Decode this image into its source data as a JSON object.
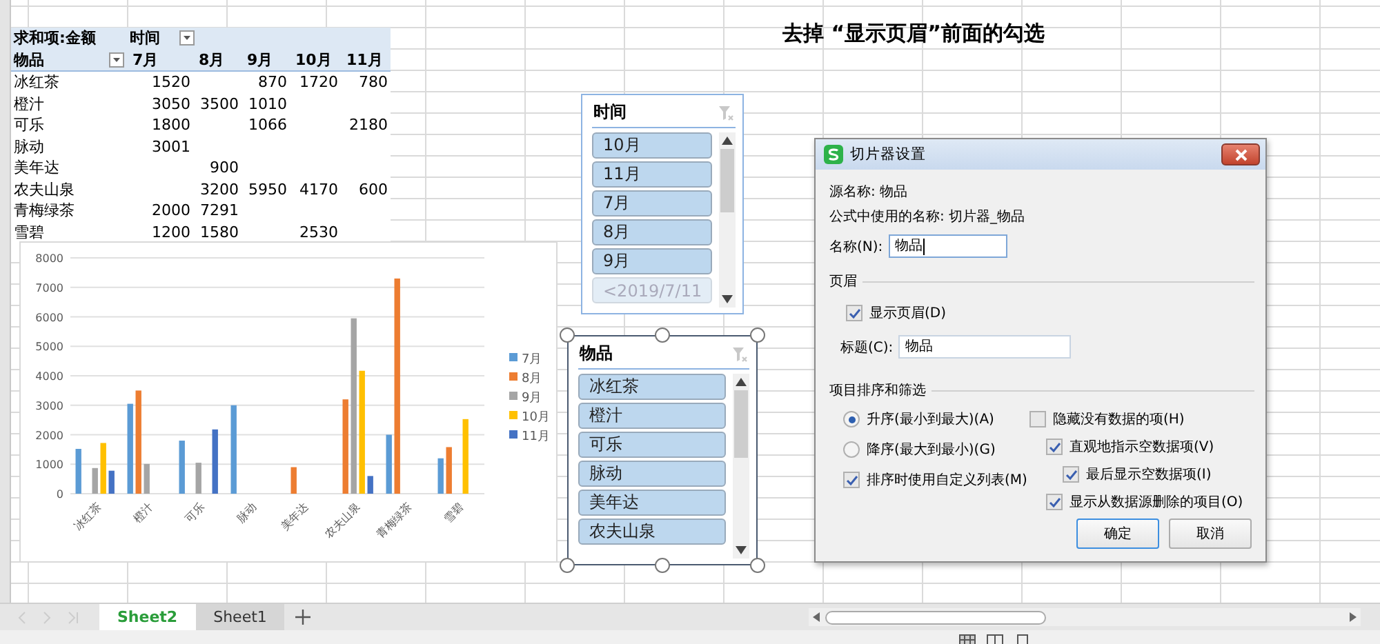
{
  "note": "去掉 “显示页眉”前面的勾选",
  "pivot": {
    "corner_label": "求和项:金额",
    "column_field": "时间",
    "row_field": "物品",
    "columns": [
      "7月",
      "8月",
      "9月",
      "10月",
      "11月"
    ],
    "rows": [
      {
        "label": "冰红茶",
        "cells": [
          "1520",
          null,
          "870",
          "1720",
          "780"
        ]
      },
      {
        "label": "橙汁",
        "cells": [
          "3050",
          "3500",
          "1010",
          null,
          null
        ]
      },
      {
        "label": "可乐",
        "cells": [
          "1800",
          null,
          "1066",
          null,
          "2180"
        ]
      },
      {
        "label": "脉动",
        "cells": [
          "3001",
          null,
          null,
          null,
          null
        ]
      },
      {
        "label": "美年达",
        "cells": [
          null,
          "900",
          null,
          null,
          null
        ]
      },
      {
        "label": "农夫山泉",
        "cells": [
          null,
          "3200",
          "5950",
          "4170",
          "600"
        ]
      },
      {
        "label": "青梅绿茶",
        "cells": [
          "2000",
          "7291",
          null,
          null,
          null
        ]
      },
      {
        "label": "雪碧",
        "cells": [
          "1200",
          "1580",
          null,
          "2530",
          null
        ]
      }
    ]
  },
  "chart": {
    "chart_data": {
      "type": "bar",
      "categories": [
        "冰红茶",
        "橙汁",
        "可乐",
        "脉动",
        "美年达",
        "农夫山泉",
        "青梅绿茶",
        "雪碧"
      ],
      "ylim": [
        0,
        8000
      ],
      "grid": true,
      "legend": "right",
      "yticks": [
        0,
        1000,
        2000,
        3000,
        4000,
        5000,
        6000,
        7000,
        8000
      ],
      "series": [
        {
          "name": "7月",
          "color": "#5b9bd5",
          "values": [
            1520,
            3050,
            1800,
            3000,
            null,
            null,
            2000,
            1200
          ]
        },
        {
          "name": "8月",
          "color": "#ed7d31",
          "values": [
            null,
            3500,
            null,
            null,
            900,
            3200,
            7300,
            1580
          ]
        },
        {
          "name": "9月",
          "color": "#a5a5a5",
          "values": [
            870,
            1010,
            1050,
            null,
            null,
            5950,
            null,
            null
          ]
        },
        {
          "name": "10月",
          "color": "#ffc000",
          "values": [
            1720,
            null,
            null,
            null,
            null,
            4170,
            null,
            2530
          ]
        },
        {
          "name": "11月",
          "color": "#4472c4",
          "values": [
            780,
            null,
            2180,
            null,
            null,
            600,
            null,
            null
          ]
        }
      ]
    }
  },
  "slicers": [
    {
      "title": "时间",
      "active": false,
      "items": [
        {
          "label": "10月",
          "selected": true,
          "dimmed": false
        },
        {
          "label": "11月",
          "selected": true,
          "dimmed": false
        },
        {
          "label": "7月",
          "selected": true,
          "dimmed": false
        },
        {
          "label": "8月",
          "selected": true,
          "dimmed": false
        },
        {
          "label": "9月",
          "selected": true,
          "dimmed": false
        },
        {
          "label": "<2019/7/11",
          "selected": true,
          "dimmed": true
        }
      ]
    },
    {
      "title": "物品",
      "active": true,
      "items": [
        {
          "label": "冰红茶",
          "selected": true,
          "dimmed": false
        },
        {
          "label": "橙汁",
          "selected": true,
          "dimmed": false
        },
        {
          "label": "可乐",
          "selected": true,
          "dimmed": false
        },
        {
          "label": "脉动",
          "selected": true,
          "dimmed": false
        },
        {
          "label": "美年达",
          "selected": true,
          "dimmed": false
        },
        {
          "label": "农夫山泉",
          "selected": true,
          "dimmed": false
        }
      ]
    }
  ],
  "dialog": {
    "title": "切片器设置",
    "info_lines": [
      "源名称: 物品",
      "公式中使用的名称: 切片器_物品"
    ],
    "name_field": {
      "label": "名称(N):",
      "value": "物品",
      "focused": true
    },
    "header_section": {
      "title": "页眉",
      "show_header": {
        "label": "显示页眉(D)",
        "checked": true
      },
      "caption_field": {
        "label": "标题(C):",
        "value": "物品"
      }
    },
    "sort_section": {
      "title": "项目排序和筛选",
      "sort_order": [
        {
          "label": "升序(最小到最大)(A)",
          "selected": true
        },
        {
          "label": "降序(最大到最小)(G)",
          "selected": false
        }
      ],
      "custom_list": {
        "label": "排序时使用自定义列表(M)",
        "checked": true
      },
      "filters": [
        {
          "label": "隐藏没有数据的项(H)",
          "checked": false,
          "children": [
            {
              "label": "直观地指示空数据项(V)",
              "checked": true,
              "children": [
                {
                  "label": "最后显示空数据项(I)",
                  "checked": true
                }
              ]
            },
            {
              "label": "显示从数据源删除的项目(O)",
              "checked": true
            }
          ]
        }
      ]
    },
    "buttons": [
      {
        "label": "确定",
        "default": true
      },
      {
        "label": "取消",
        "default": false
      }
    ]
  },
  "sheet_tabs": [
    {
      "label": "Sheet2",
      "selected": true
    },
    {
      "label": "Sheet1",
      "selected": false
    }
  ]
}
